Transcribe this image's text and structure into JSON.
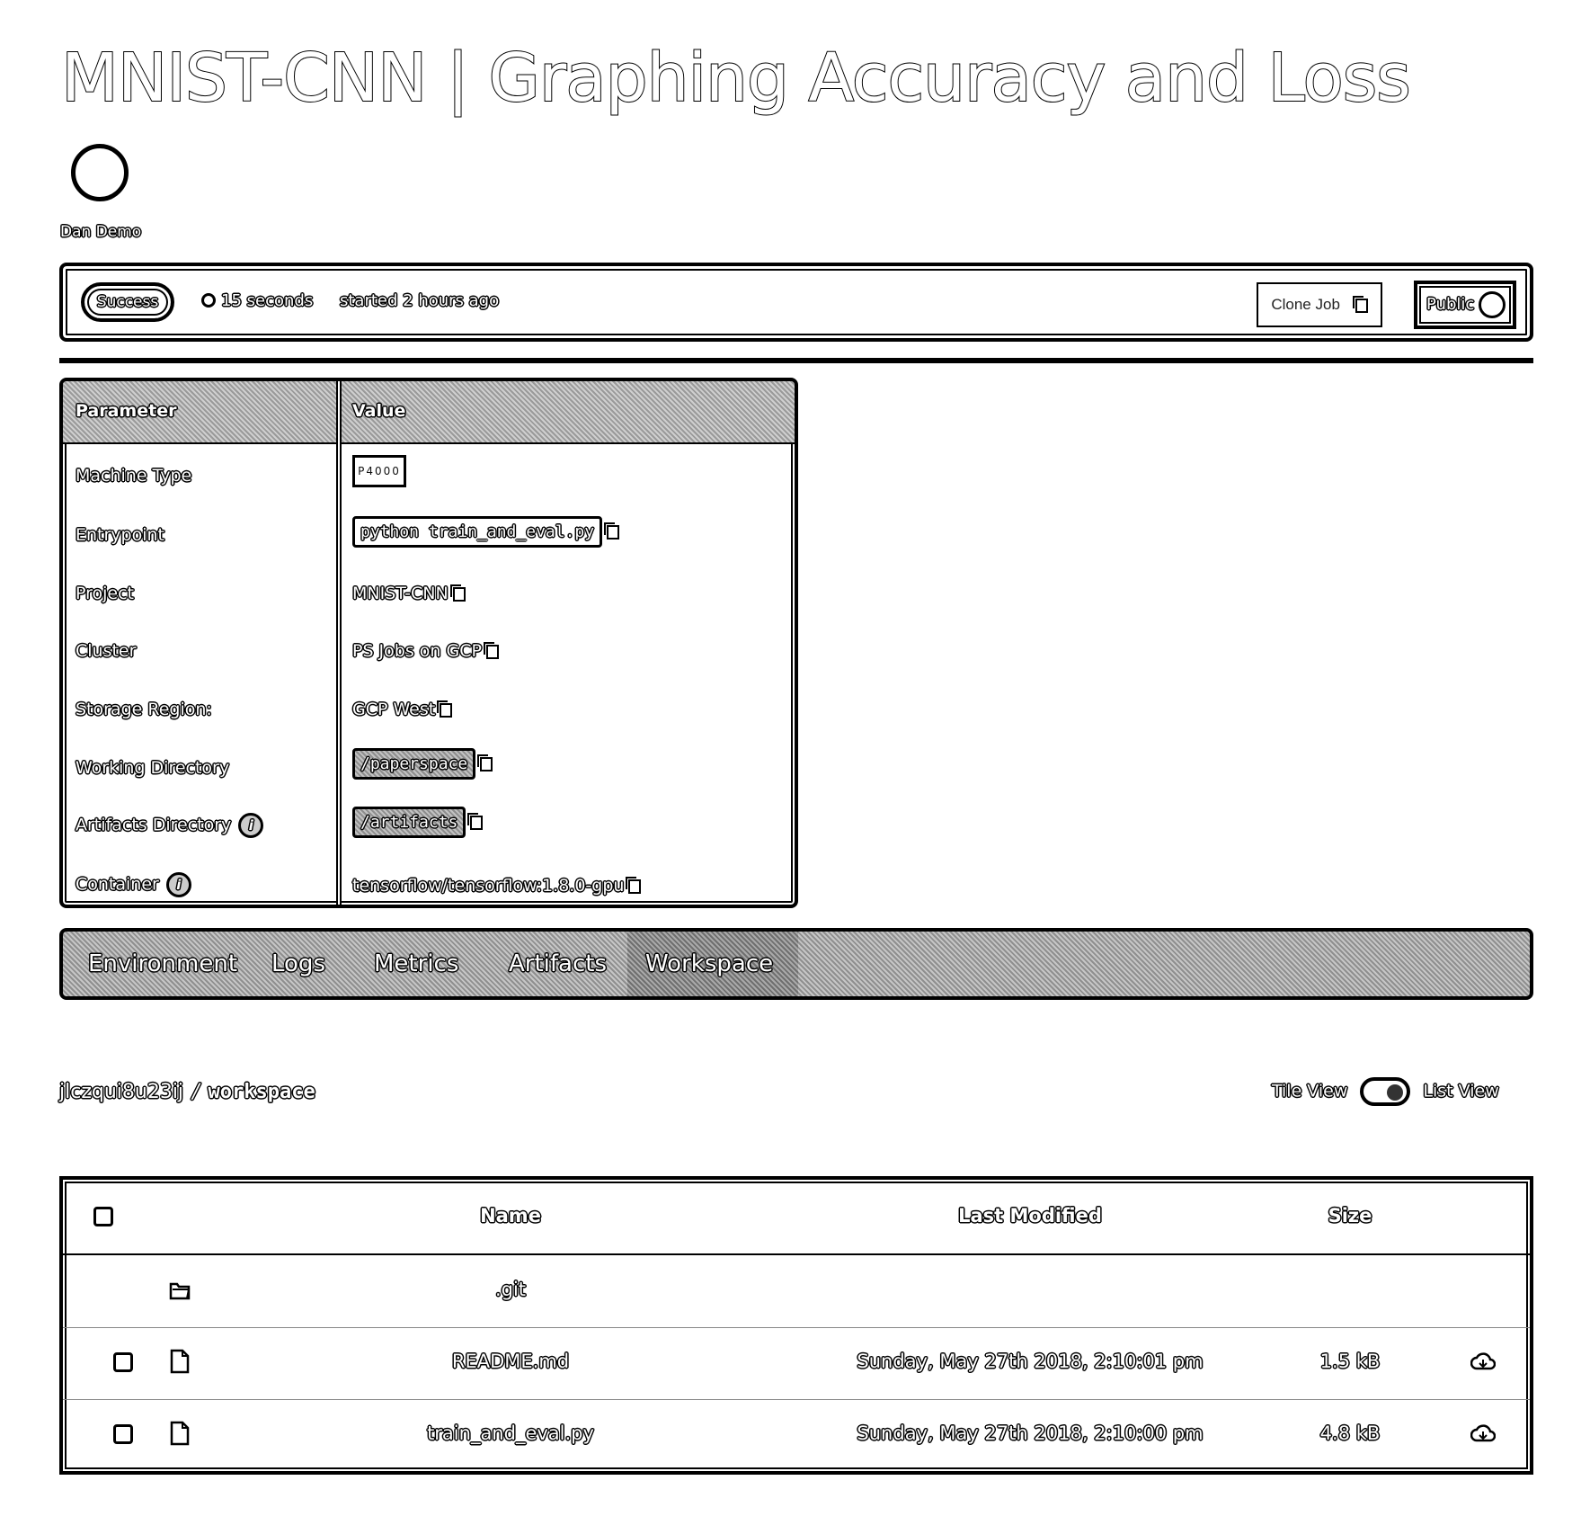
{
  "header": {
    "project": "MNIST-CNN",
    "separator": "|",
    "job_name": "Graphing Accuracy and Loss",
    "owner": "Dan Demo"
  },
  "status": {
    "state": "Success",
    "duration": "15 seconds",
    "started": "started 2 hours ago",
    "clone_label": "Clone Job",
    "visibility_label": "Public"
  },
  "params": {
    "col_parameter": "Parameter",
    "col_value": "Value",
    "rows": [
      {
        "key": "Machine Type",
        "value": "P4000"
      },
      {
        "key": "Entrypoint",
        "value": "python train_and_eval.py"
      },
      {
        "key": "Project",
        "value": "MNIST-CNN"
      },
      {
        "key": "Cluster",
        "value": "PS Jobs on GCP"
      },
      {
        "key": "Storage Region:",
        "value": "GCP West"
      },
      {
        "key": "Working Directory",
        "value": "/paperspace"
      },
      {
        "key": "Artifacts Directory",
        "value": "/artifacts"
      },
      {
        "key": "Container",
        "value": "tensorflow/tensorflow:1.8.0-gpu"
      }
    ]
  },
  "tabs": [
    "Environment",
    "Logs",
    "Metrics",
    "Artifacts",
    "Workspace"
  ],
  "active_tab": "Workspace",
  "breadcrumb": {
    "job_id": "jlczqui8u23ij",
    "sep": "/",
    "folder": "workspace"
  },
  "view_toggle": {
    "left": "Tile View",
    "right": "List View",
    "selected": "List View"
  },
  "files": {
    "headers": {
      "name": "Name",
      "modified": "Last Modified",
      "size": "Size"
    },
    "rows": [
      {
        "type": "folder",
        "name": ".git",
        "modified": "",
        "size": ""
      },
      {
        "type": "file",
        "name": "README.md",
        "modified": "Sunday, May 27th 2018, 2:10:01 pm",
        "size": "1.5 kB"
      },
      {
        "type": "file",
        "name": "train_and_eval.py",
        "modified": "Sunday, May 27th 2018, 2:10:00 pm",
        "size": "4.8 kB"
      }
    ]
  }
}
